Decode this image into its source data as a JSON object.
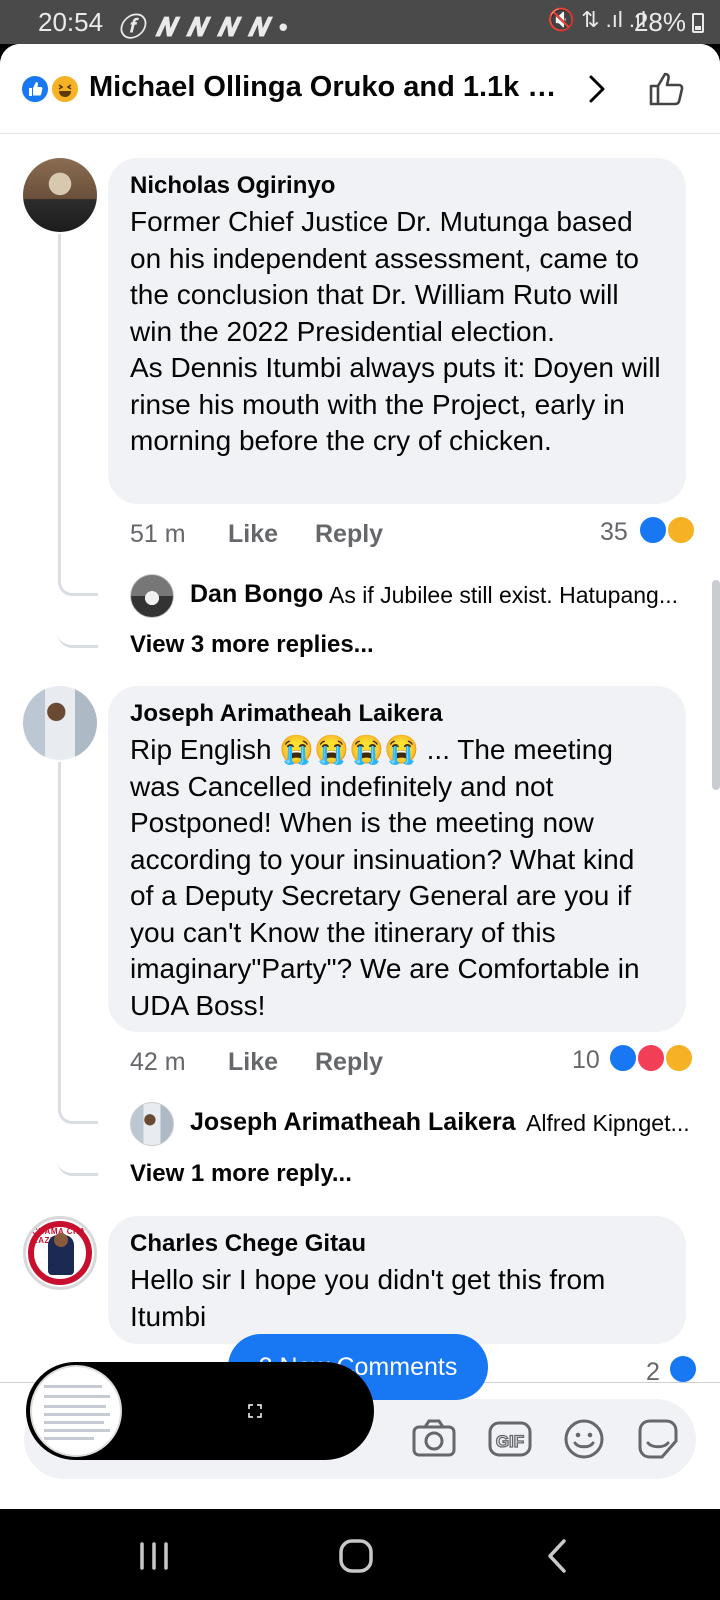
{
  "status_bar": {
    "time": "20:54",
    "left_icons": "ⓕ 𝑵 𝑵 𝑵 𝑵 •",
    "right_icons": "🔇 ⇅ .ıl .ıl",
    "battery": "28%"
  },
  "header": {
    "title": "Michael Ollinga Oruko and 1.1k ot...",
    "reaction_icons": [
      "like-icon",
      "haha-icon"
    ]
  },
  "comments": [
    {
      "author": "Nicholas Ogirinyo",
      "text": "Former Chief Justice Dr. Mutunga based on his independent assessment, came to the conclusion that Dr. William Ruto will win the 2022 Presidential election.\nAs Dennis Itumbi always puts it: Doyen will rinse his mouth with the Project, early in morning before the cry of chicken.",
      "time": "51 m",
      "like_label": "Like",
      "reply_label": "Reply",
      "reaction_count": "35",
      "reactions": [
        "like",
        "haha"
      ],
      "reply_preview": {
        "author": "Dan Bongo",
        "text": "As if Jubilee still exist. Hatupang..."
      },
      "view_more": "View 3 more replies..."
    },
    {
      "author": "Joseph Arimatheah Laikera",
      "text": "Rip English 😭😭😭😭 ... The meeting was Cancelled indefinitely and not Postponed!  When is the meeting now according to your insinuation? What kind of a Deputy Secretary General are you if you can't Know the itinerary of this imaginary\"Party\"? We are Comfortable in UDA Boss!",
      "time": "42 m",
      "like_label": "Like",
      "reply_label": "Reply",
      "reaction_count": "10",
      "reactions": [
        "like",
        "love",
        "haha"
      ],
      "reply_preview": {
        "author": "Joseph Arimatheah Laikera",
        "text": "Alfred Kipnget..."
      },
      "view_more": "View 1 more reply..."
    },
    {
      "author": "Charles Chege Gitau",
      "text": "Hello sir I hope you didn't get this from Itumbi",
      "reaction_count": "2",
      "reactions": [
        "like"
      ]
    }
  ],
  "new_comments_pill": "2 New Comments",
  "avatar3_text": "CHAMA CHA KAZI",
  "composer": {
    "icons": [
      "camera-icon",
      "gif-icon",
      "emoji-icon",
      "sticker-icon"
    ]
  },
  "nav": [
    "recents-button",
    "home-button",
    "back-button"
  ]
}
